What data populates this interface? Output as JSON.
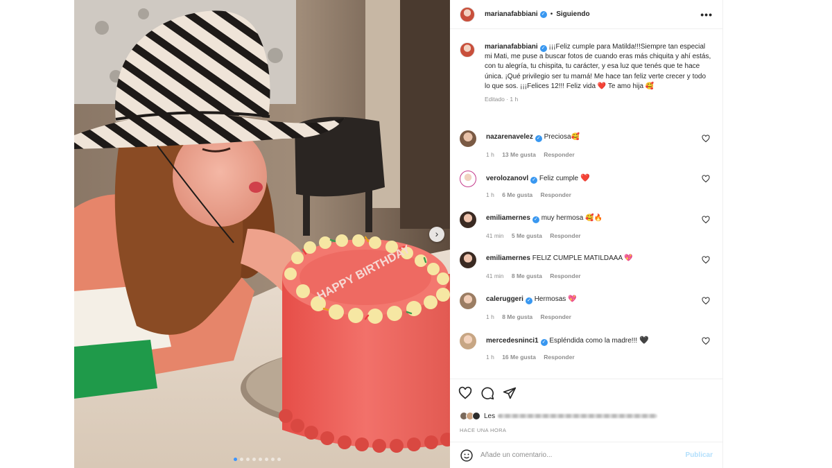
{
  "post": {
    "owner": "marianafabbiani",
    "follow_status": "Siguiendo",
    "more_label": "•••",
    "separator": "•",
    "caption": "¡¡¡Feliz cumple para Matilda!!!Siempre tan especial mi Mati, me puse a buscar fotos de cuando eras más chiquita y ahí estás, con tu alegría, tu chispita, tu carácter, y esa luz que tenés que te hace única. ¡Qué privilegio ser tu mamá! Me hace tan feliz verte crecer y todo lo que sos. ¡¡¡Felices 12!!! Feliz vida ❤️ Te amo hija 🥰",
    "edited": "Editado · 1 h"
  },
  "photo": {
    "cake_text": "HAPPY BIRTHDAY",
    "next_arrow": "›"
  },
  "comments": [
    {
      "user": "nazarenavelez",
      "text": "Preciosa",
      "time": "1 h",
      "likes": "13 Me gusta",
      "reply": "Responder",
      "emoji": "🥰"
    },
    {
      "user": "verolozanovl",
      "text": "Feliz cumple",
      "time": "1 h",
      "likes": "6 Me gusta",
      "reply": "Responder",
      "emoji": "❤️"
    },
    {
      "user": "emiliamernes",
      "text": "muy hermosa",
      "time": "41 min",
      "likes": "5 Me gusta",
      "reply": "Responder",
      "emoji": "🥰🔥"
    },
    {
      "user": "emiliamernes",
      "text": "FELIZ CUMPLE MATILDAAA",
      "time": "41 min",
      "likes": "8 Me gusta",
      "reply": "Responder",
      "emoji": "💖"
    },
    {
      "user": "caleruggeri",
      "text": "Hermosas",
      "time": "1 h",
      "likes": "8 Me gusta",
      "reply": "Responder",
      "emoji": "💖"
    },
    {
      "user": "mercedesninci1",
      "text": "Espléndida como la madre!!!",
      "time": "1 h",
      "likes": "16 Me gusta",
      "reply": "Responder",
      "emoji": "🖤"
    }
  ],
  "likes": {
    "prefix": "Les"
  },
  "timestamp": "HACE UNA HORA",
  "add_comment": {
    "placeholder": "Añade un comentario...",
    "publish": "Publicar"
  },
  "icons": [
    "like-icon",
    "comment-icon",
    "share-icon",
    "emoji-icon",
    "more-icon",
    "verified-icon",
    "heart-outline-icon"
  ],
  "colors": {
    "verified": "#3897f0",
    "link_disabled": "#b2dffc",
    "cake": "#f0605a",
    "secondary_text": "#8e8e8e"
  }
}
